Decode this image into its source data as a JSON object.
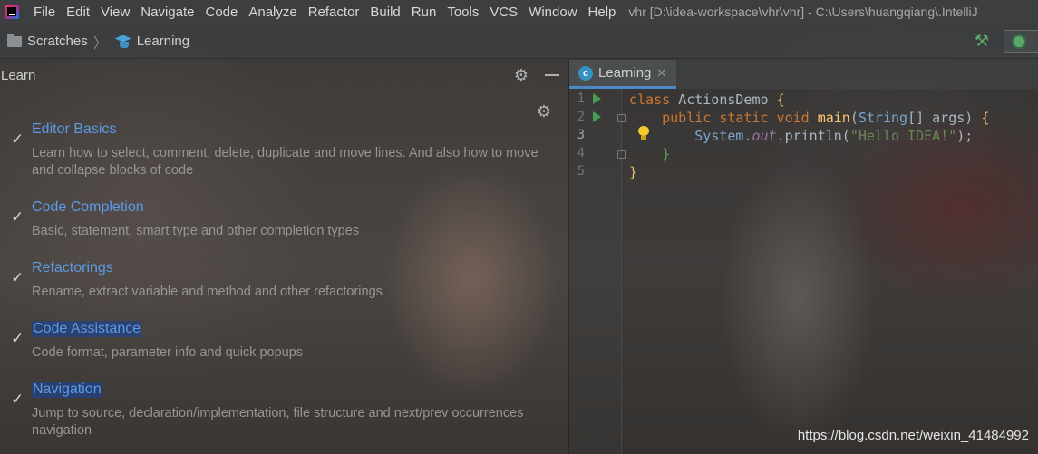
{
  "app": {
    "menu": [
      "File",
      "Edit",
      "View",
      "Navigate",
      "Code",
      "Analyze",
      "Refactor",
      "Build",
      "Run",
      "Tools",
      "VCS",
      "Window",
      "Help"
    ],
    "title": "vhr [D:\\idea-workspace\\vhr\\vhr] - C:\\Users\\huangqiang\\.IntelliJ"
  },
  "breadcrumb": {
    "scratches": "Scratches",
    "learning": "Learning"
  },
  "learn_panel": {
    "title": "Learn",
    "lessons": [
      {
        "title": "Editor Basics",
        "desc": "Learn how to select, comment, delete, duplicate and move lines. And also how to move and collapse blocks of code",
        "completed": true
      },
      {
        "title": "Code Completion",
        "desc": "Basic, statement, smart type and other completion types",
        "completed": true
      },
      {
        "title": "Refactorings",
        "desc": "Rename, extract variable and method and other refactorings",
        "completed": true
      },
      {
        "title": "Code Assistance",
        "desc": "Code format, parameter info and quick popups",
        "completed": true
      },
      {
        "title": "Navigation",
        "desc": "Jump to source, declaration/implementation, file structure and next/prev occurrences navigation",
        "completed": true
      }
    ]
  },
  "editor": {
    "tab": "Learning",
    "line_numbers": [
      "1",
      "2",
      "3",
      "4",
      "5"
    ],
    "code": {
      "l1_kw": "class ",
      "l1_name": "ActionsDemo ",
      "l1_brace": "{",
      "l2_indent": "    ",
      "l2_kw": "public static void ",
      "l2_fn": "main",
      "l2_paren": "(",
      "l2_type": "String",
      "l2_rest": "[] args) ",
      "l2_brace": "{",
      "l3_indent": "        ",
      "l3_cls": "System.",
      "l3_fld": "out",
      "l3_call": ".println(",
      "l3_str": "\"Hello IDEA!\"",
      "l3_end": ");",
      "l4_indent": "    ",
      "l4_brace": "}",
      "l5_brace": "}"
    }
  },
  "watermark": "https://blog.csdn.net/weixin_41484992",
  "colors": {
    "link": "#5c9be6",
    "keyword": "#cc7832",
    "string": "#6a8759",
    "field": "#9876aa",
    "run_green": "#499c54"
  }
}
